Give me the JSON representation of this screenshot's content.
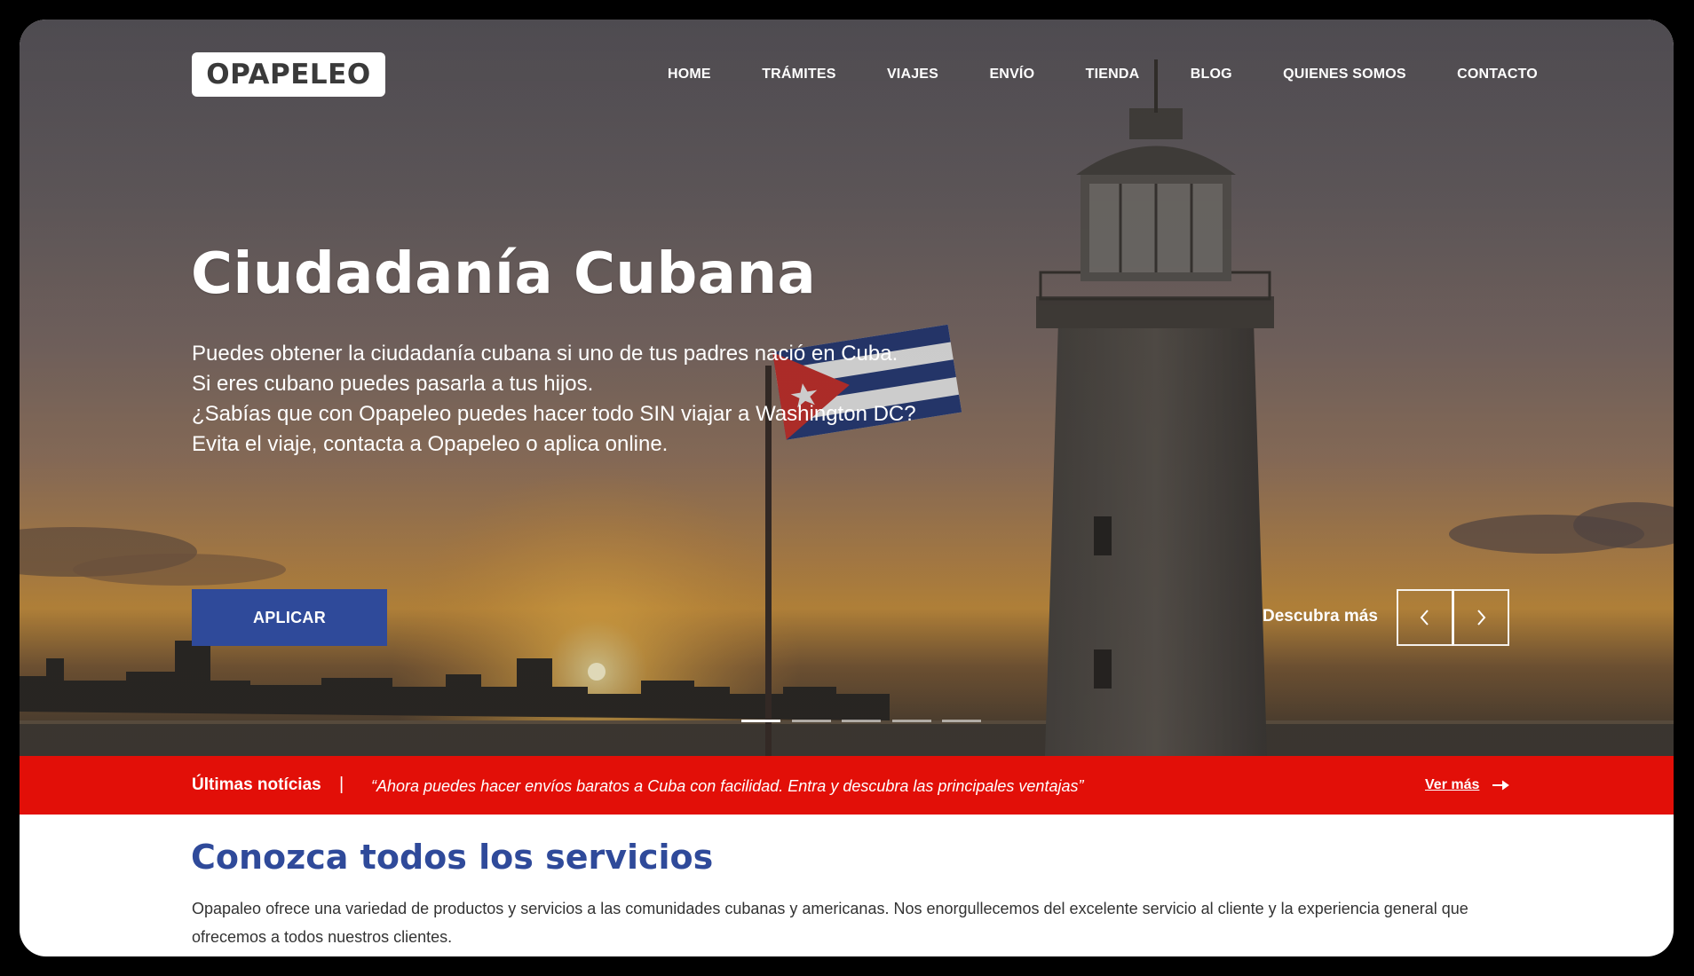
{
  "header": {
    "logo_text": "OPAPELEO",
    "nav": [
      "HOME",
      "TRÁMITES",
      "VIAJES",
      "ENVÍO",
      "TIENDA",
      "BLOG",
      "QUIENES SOMOS",
      "CONTACTO"
    ]
  },
  "hero": {
    "title": "Ciudadanía Cubana",
    "lines": [
      "Puedes obtener la ciudadanía cubana si uno de tus padres nació en Cuba.",
      "Si eres cubano puedes pasarla a tus hijos.",
      "¿Sabías que con Opapeleo puedes hacer todo SIN viajar a Washington DC?",
      "Evita el viaje, contacta a Opapeleo o aplica online."
    ],
    "apply_label": "APLICAR",
    "discover_label": "Descubra más",
    "slides": {
      "total": 5,
      "active": 1
    }
  },
  "news": {
    "label": "Últimas notícias",
    "separator": "|",
    "text": "“Ahora puedes hacer envíos baratos a Cuba con facilidad. Entra y descubra las principales ventajas”",
    "more_label": "Ver más"
  },
  "services": {
    "title": "Conozca todos los servicios",
    "description": "Opapaleo ofrece una variedad de productos y servicios a las comunidades cubanas y americanas. Nos enorgullecemos del excelente servicio al cliente y la experiencia general que ofrecemos a todos nuestros clientes."
  },
  "colors": {
    "primary_blue": "#2f4a9a",
    "news_red": "#e20f08",
    "text_dark": "#333333"
  },
  "icons": {
    "prev": "chevron-left-icon",
    "next": "chevron-right-icon",
    "news_more": "arrow-right-icon"
  }
}
